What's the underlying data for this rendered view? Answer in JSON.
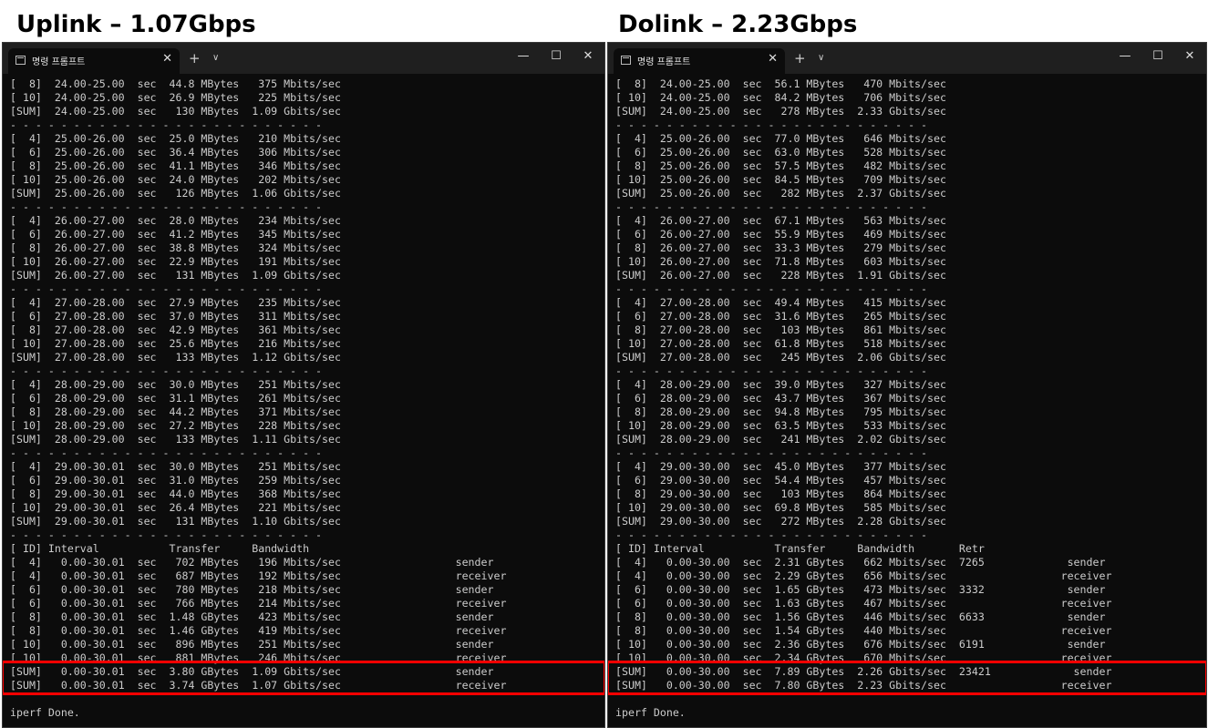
{
  "left": {
    "heading": "Uplink – 1.07Gbps",
    "tab_title": "명령 프롬프트",
    "lines": [
      "[  8]  24.00-25.00  sec  44.8 MBytes   375 Mbits/sec",
      "[ 10]  24.00-25.00  sec  26.9 MBytes   225 Mbits/sec",
      "[SUM]  24.00-25.00  sec   130 MBytes  1.09 Gbits/sec",
      "- - - - - - - - - - - - - - - - - - - - - - - - -",
      "[  4]  25.00-26.00  sec  25.0 MBytes   210 Mbits/sec",
      "[  6]  25.00-26.00  sec  36.4 MBytes   306 Mbits/sec",
      "[  8]  25.00-26.00  sec  41.1 MBytes   346 Mbits/sec",
      "[ 10]  25.00-26.00  sec  24.0 MBytes   202 Mbits/sec",
      "[SUM]  25.00-26.00  sec   126 MBytes  1.06 Gbits/sec",
      "- - - - - - - - - - - - - - - - - - - - - - - - -",
      "[  4]  26.00-27.00  sec  28.0 MBytes   234 Mbits/sec",
      "[  6]  26.00-27.00  sec  41.2 MBytes   345 Mbits/sec",
      "[  8]  26.00-27.00  sec  38.8 MBytes   324 Mbits/sec",
      "[ 10]  26.00-27.00  sec  22.9 MBytes   191 Mbits/sec",
      "[SUM]  26.00-27.00  sec   131 MBytes  1.09 Gbits/sec",
      "- - - - - - - - - - - - - - - - - - - - - - - - -",
      "[  4]  27.00-28.00  sec  27.9 MBytes   235 Mbits/sec",
      "[  6]  27.00-28.00  sec  37.0 MBytes   311 Mbits/sec",
      "[  8]  27.00-28.00  sec  42.9 MBytes   361 Mbits/sec",
      "[ 10]  27.00-28.00  sec  25.6 MBytes   216 Mbits/sec",
      "[SUM]  27.00-28.00  sec   133 MBytes  1.12 Gbits/sec",
      "- - - - - - - - - - - - - - - - - - - - - - - - -",
      "[  4]  28.00-29.00  sec  30.0 MBytes   251 Mbits/sec",
      "[  6]  28.00-29.00  sec  31.1 MBytes   261 Mbits/sec",
      "[  8]  28.00-29.00  sec  44.2 MBytes   371 Mbits/sec",
      "[ 10]  28.00-29.00  sec  27.2 MBytes   228 Mbits/sec",
      "[SUM]  28.00-29.00  sec   133 MBytes  1.11 Gbits/sec",
      "- - - - - - - - - - - - - - - - - - - - - - - - -",
      "[  4]  29.00-30.01  sec  30.0 MBytes   251 Mbits/sec",
      "[  6]  29.00-30.01  sec  31.0 MBytes   259 Mbits/sec",
      "[  8]  29.00-30.01  sec  44.0 MBytes   368 Mbits/sec",
      "[ 10]  29.00-30.01  sec  26.4 MBytes   221 Mbits/sec",
      "[SUM]  29.00-30.01  sec   131 MBytes  1.10 Gbits/sec",
      "- - - - - - - - - - - - - - - - - - - - - - - - -",
      "[ ID] Interval           Transfer     Bandwidth",
      "[  4]   0.00-30.01  sec   702 MBytes   196 Mbits/sec                  sender",
      "[  4]   0.00-30.01  sec   687 MBytes   192 Mbits/sec                  receiver",
      "[  6]   0.00-30.01  sec   780 MBytes   218 Mbits/sec                  sender",
      "[  6]   0.00-30.01  sec   766 MBytes   214 Mbits/sec                  receiver",
      "[  8]   0.00-30.01  sec  1.48 GBytes   423 Mbits/sec                  sender",
      "[  8]   0.00-30.01  sec  1.46 GBytes   419 Mbits/sec                  receiver",
      "[ 10]   0.00-30.01  sec   896 MBytes   251 Mbits/sec                  sender",
      "[ 10]   0.00-30.01  sec   881 MBytes   246 Mbits/sec                  receiver",
      "[SUM]   0.00-30.01  sec  3.80 GBytes  1.09 Gbits/sec                  sender",
      "[SUM]   0.00-30.01  sec  3.74 GBytes  1.07 Gbits/sec                  receiver",
      "",
      "iperf Done."
    ]
  },
  "right": {
    "heading": "Dolink – 2.23Gbps",
    "tab_title": "명령 프롬프트",
    "lines": [
      "[  8]  24.00-25.00  sec  56.1 MBytes   470 Mbits/sec",
      "[ 10]  24.00-25.00  sec  84.2 MBytes   706 Mbits/sec",
      "[SUM]  24.00-25.00  sec   278 MBytes  2.33 Gbits/sec",
      "- - - - - - - - - - - - - - - - - - - - - - - - -",
      "[  4]  25.00-26.00  sec  77.0 MBytes   646 Mbits/sec",
      "[  6]  25.00-26.00  sec  63.0 MBytes   528 Mbits/sec",
      "[  8]  25.00-26.00  sec  57.5 MBytes   482 Mbits/sec",
      "[ 10]  25.00-26.00  sec  84.5 MBytes   709 Mbits/sec",
      "[SUM]  25.00-26.00  sec   282 MBytes  2.37 Gbits/sec",
      "- - - - - - - - - - - - - - - - - - - - - - - - -",
      "[  4]  26.00-27.00  sec  67.1 MBytes   563 Mbits/sec",
      "[  6]  26.00-27.00  sec  55.9 MBytes   469 Mbits/sec",
      "[  8]  26.00-27.00  sec  33.3 MBytes   279 Mbits/sec",
      "[ 10]  26.00-27.00  sec  71.8 MBytes   603 Mbits/sec",
      "[SUM]  26.00-27.00  sec   228 MBytes  1.91 Gbits/sec",
      "- - - - - - - - - - - - - - - - - - - - - - - - -",
      "[  4]  27.00-28.00  sec  49.4 MBytes   415 Mbits/sec",
      "[  6]  27.00-28.00  sec  31.6 MBytes   265 Mbits/sec",
      "[  8]  27.00-28.00  sec   103 MBytes   861 Mbits/sec",
      "[ 10]  27.00-28.00  sec  61.8 MBytes   518 Mbits/sec",
      "[SUM]  27.00-28.00  sec   245 MBytes  2.06 Gbits/sec",
      "- - - - - - - - - - - - - - - - - - - - - - - - -",
      "[  4]  28.00-29.00  sec  39.0 MBytes   327 Mbits/sec",
      "[  6]  28.00-29.00  sec  43.7 MBytes   367 Mbits/sec",
      "[  8]  28.00-29.00  sec  94.8 MBytes   795 Mbits/sec",
      "[ 10]  28.00-29.00  sec  63.5 MBytes   533 Mbits/sec",
      "[SUM]  28.00-29.00  sec   241 MBytes  2.02 Gbits/sec",
      "- - - - - - - - - - - - - - - - - - - - - - - - -",
      "[  4]  29.00-30.00  sec  45.0 MBytes   377 Mbits/sec",
      "[  6]  29.00-30.00  sec  54.4 MBytes   457 Mbits/sec",
      "[  8]  29.00-30.00  sec   103 MBytes   864 Mbits/sec",
      "[ 10]  29.00-30.00  sec  69.8 MBytes   585 Mbits/sec",
      "[SUM]  29.00-30.00  sec   272 MBytes  2.28 Gbits/sec",
      "- - - - - - - - - - - - - - - - - - - - - - - - -",
      "[ ID] Interval           Transfer     Bandwidth       Retr",
      "[  4]   0.00-30.00  sec  2.31 GBytes   662 Mbits/sec  7265             sender",
      "[  4]   0.00-30.00  sec  2.29 GBytes   656 Mbits/sec                  receiver",
      "[  6]   0.00-30.00  sec  1.65 GBytes   473 Mbits/sec  3332             sender",
      "[  6]   0.00-30.00  sec  1.63 GBytes   467 Mbits/sec                  receiver",
      "[  8]   0.00-30.00  sec  1.56 GBytes   446 Mbits/sec  6633             sender",
      "[  8]   0.00-30.00  sec  1.54 GBytes   440 Mbits/sec                  receiver",
      "[ 10]   0.00-30.00  sec  2.36 GBytes   676 Mbits/sec  6191             sender",
      "[ 10]   0.00-30.00  sec  2.34 GBytes   670 Mbits/sec                  receiver",
      "[SUM]   0.00-30.00  sec  7.89 GBytes  2.26 Gbits/sec  23421             sender",
      "[SUM]   0.00-30.00  sec  7.80 GBytes  2.23 Gbits/sec                  receiver",
      "",
      "iperf Done."
    ]
  },
  "icons": {
    "tab_icon": "terminal-icon",
    "close": "close-icon",
    "new_tab": "plus-icon",
    "dropdown": "chevron-down-icon",
    "minimize": "minimize-icon",
    "maximize": "maximize-icon"
  },
  "glyphs": {
    "close": "✕",
    "plus": "+",
    "chevron": "∨",
    "minimize": "—",
    "maximize": "☐"
  },
  "colors": {
    "terminal_bg": "#0c0c0c",
    "terminal_text": "#cccccc",
    "titlebar_bg": "#1f1f1f",
    "highlight": "#ff0000"
  }
}
